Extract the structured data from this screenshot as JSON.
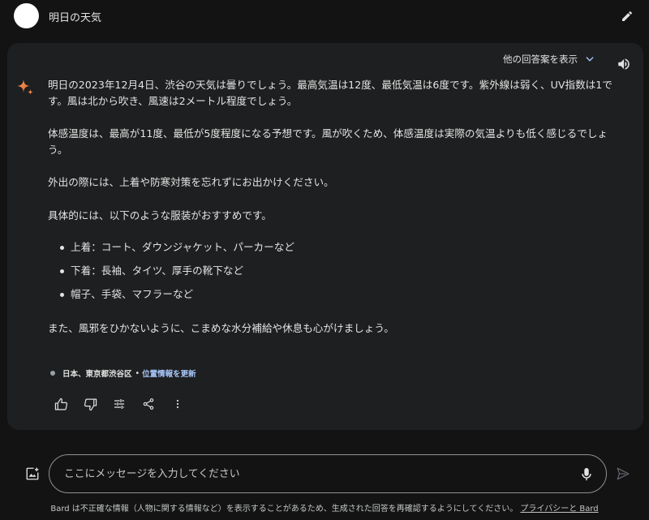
{
  "prompt": {
    "text": "明日の天気"
  },
  "response": {
    "drafts_label": "他の回答案を表示",
    "paragraphs": {
      "p1": "明日の2023年12月4日、渋谷の天気は曇りでしょう。最高気温は12度、最低気温は6度です。紫外線は弱く、UV指数は1です。風は北から吹き、風速は2メートル程度でしょう。",
      "p2": "体感温度は、最高が11度、最低が5度程度になる予想です。風が吹くため、体感温度は実際の気温よりも低く感じるでしょう。",
      "p3": "外出の際には、上着や防寒対策を忘れずにお出かけください。",
      "p4": "具体的には、以下のような服装がおすすめです。",
      "p5": "また、風邪をひかないように、こまめな水分補給や休息も心がけましょう。"
    },
    "bullets": [
      "上着：コート、ダウンジャケット、パーカーなど",
      "下着：長袖、タイツ、厚手の靴下など",
      "帽子、手袋、マフラーなど"
    ],
    "location": {
      "place": "日本、東京都渋谷区",
      "separator": "•",
      "update_link": "位置情報を更新"
    }
  },
  "input": {
    "placeholder": "ここにメッセージを入力してください",
    "value": ""
  },
  "footer": {
    "disclaimer": "Bard は不正確な情報（人物に関する情報など）を表示することがあるため、生成された回答を再確認するようにしてください。",
    "privacy_link": "プライバシーと Bard"
  },
  "icons": {
    "edit": "pencil-icon",
    "drafts": "chevron-down-icon",
    "speak": "speaker-icon",
    "sparkle": "bard-sparkle-icon",
    "thumbs_up": "thumbs-up-icon",
    "thumbs_down": "thumbs-down-icon",
    "modify": "tune-icon",
    "share": "share-icon",
    "more": "more-vert-icon",
    "image_add": "add-image-icon",
    "mic": "microphone-icon",
    "send": "send-icon"
  },
  "colors": {
    "background": "#131314",
    "card": "#1e1f20",
    "text": "#e3e3e3",
    "link": "#a8c7fa",
    "chevron": "#a8c7fa"
  }
}
